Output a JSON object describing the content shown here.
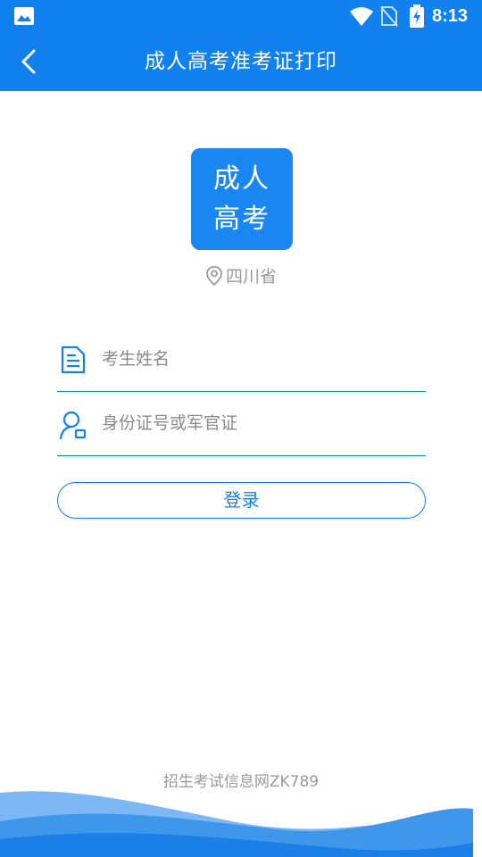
{
  "status_bar": {
    "time": "8:13",
    "icons": [
      "image-icon",
      "wifi-icon",
      "no-sim-icon",
      "battery-charging-icon"
    ]
  },
  "app_bar": {
    "title": "成人高考准考证打印",
    "back_icon": "back-arrow-icon"
  },
  "logo": {
    "line1": "成人",
    "line2": "高考",
    "bg_color": "#1a86f2"
  },
  "region": {
    "icon": "location-pin-icon",
    "label": "四川省"
  },
  "form": {
    "name_field": {
      "icon": "document-icon",
      "placeholder": "考生姓名",
      "value": ""
    },
    "id_field": {
      "icon": "user-id-icon",
      "placeholder": "身份证号或军官证",
      "value": ""
    },
    "login_label": "登录"
  },
  "footer": {
    "text": "招生考试信息网ZK789"
  },
  "colors": {
    "primary": "#1181f0",
    "muted_text": "#9a9a9a",
    "background": "#ffffff"
  }
}
